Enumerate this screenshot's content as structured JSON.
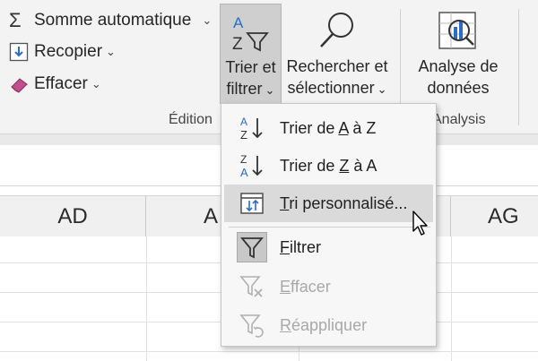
{
  "ribbon": {
    "autosum_label": "Somme automatique",
    "fill_label": "Recopier",
    "clear_label": "Effacer",
    "sort_filter_line1": "Trier et",
    "sort_filter_line2": "filtrer",
    "find_select_line1": "Rechercher et",
    "find_select_line2": "sélectionner",
    "analyze_line1": "Analyse de",
    "analyze_line2": "données",
    "group_editing": "Édition",
    "group_analysis": "Analysis",
    "chevron": "⌄"
  },
  "menu": {
    "items": [
      {
        "pre": "Trier de ",
        "ul": "A",
        "post": " à Z",
        "icon": "sort-a-to-z-icon",
        "state": "normal"
      },
      {
        "pre": "Trier de ",
        "ul": "Z",
        "post": " à A",
        "icon": "sort-z-to-a-icon",
        "state": "normal"
      },
      {
        "pre": "",
        "ul": "T",
        "post": "ri personnalisé...",
        "icon": "custom-sort-icon",
        "state": "hover"
      },
      {
        "pre": "",
        "ul": "F",
        "post": "iltrer",
        "icon": "filter-icon",
        "state": "checked"
      },
      {
        "pre": "",
        "ul": "E",
        "post": "ffacer",
        "icon": "clear-filter-icon",
        "state": "disabled"
      },
      {
        "pre": "",
        "ul": "R",
        "post": "éappliquer",
        "icon": "reapply-filter-icon",
        "state": "disabled"
      }
    ]
  },
  "sheet": {
    "columns": [
      "AD",
      "A",
      "AG"
    ]
  },
  "colors": {
    "accent_blue": "#2b6cc4",
    "clear_pink": "#c0508b",
    "disabled": "#a8a8a8"
  }
}
